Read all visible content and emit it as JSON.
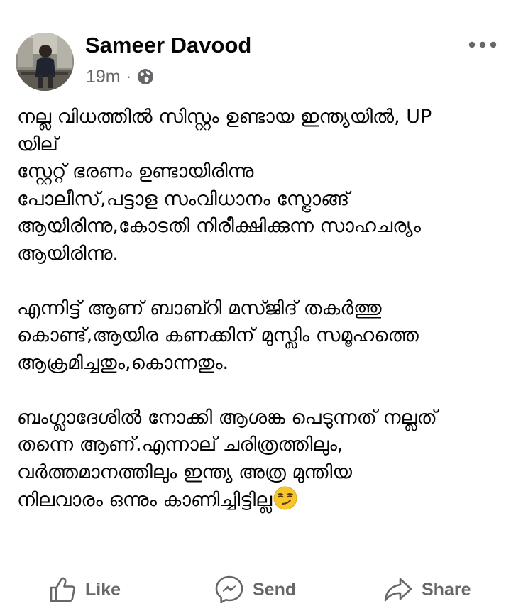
{
  "post": {
    "author": "Sameer Davood",
    "time": "19m",
    "separator": "·",
    "privacy_icon": "globe-icon",
    "more_icon": "more-options-icon",
    "body": {
      "para1": "നല്ല വിധത്തിൽ സിസ്റ്റം ഉണ്ടായ ഇന്ത്യയിൽ, UP\nയില്\nസ്റ്റേറ്റ് ഭരണം ഉണ്ടായിരിന്നു\nപോലീസ്,പട്ടാള സംവിധാനം സ്ട്രോങ്ങ്\nആയിരിന്നു,കോടതി നിരീക്ഷിക്കുന്ന സാഹചര്യം\nആയിരിന്നു.",
      "para2": "എന്നിട്ട് ആണ് ബാബ്റി മസ്ജിദ് തകർത്തു\nകൊണ്ട്,ആയിര കണക്കിന് മുസ്ലിം സമൂഹത്തെ\nആക്രമിച്ചതും,കൊന്നതും.",
      "para3": "ബംഗ്ലാദേശിൽ നോക്കി ആശങ്ക പെടുന്നത് നല്ലത്\nതന്നെ ആണ്.എന്നാല് ചരിത്രത്തിലും,\nവർത്തമാനത്തിലും ഇന്ത്യ അത്ര മുന്തിയ\nനിലവാരം ഒന്നും കാണിച്ചിട്ടില്ല",
      "emoji": "smirking-face-emoji"
    }
  },
  "actions": {
    "like": {
      "label": "Like",
      "icon": "thumbs-up-icon"
    },
    "send": {
      "label": "Send",
      "icon": "messenger-icon"
    },
    "share": {
      "label": "Share",
      "icon": "share-arrow-icon"
    }
  },
  "colors": {
    "text": "#050505",
    "secondary": "#65676b",
    "emoji_yellow": "#f7c62b"
  }
}
